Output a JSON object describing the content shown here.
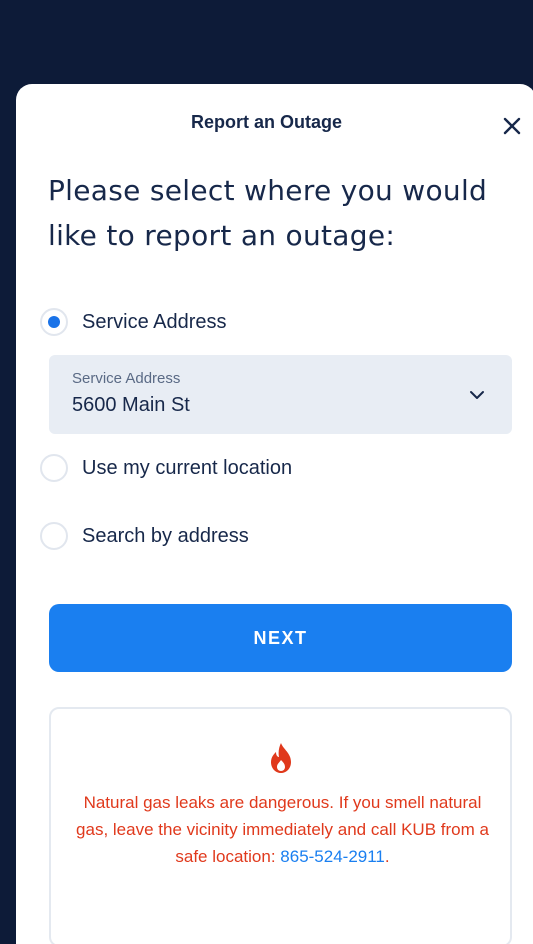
{
  "header": {
    "title": "Report an Outage"
  },
  "prompt": "Please select where you would like to report an outage:",
  "options": [
    {
      "label": "Service Address",
      "selected": true
    },
    {
      "label": "Use my current location",
      "selected": false
    },
    {
      "label": "Search by address",
      "selected": false
    }
  ],
  "service_select": {
    "caption": "Service Address",
    "value": "5600 Main St"
  },
  "next_label": "NEXT",
  "warning": {
    "text": "Natural gas leaks are dangerous. If you smell natural gas, leave the vicinity immediately and call KUB from a safe location: ",
    "phone": "865-524-2911",
    "suffix": ".",
    "icon": "flame-icon"
  },
  "colors": {
    "accent": "#1a7ff0",
    "warning": "#e0391c",
    "navy": "#17284a",
    "backdrop": "#0d1b38"
  }
}
